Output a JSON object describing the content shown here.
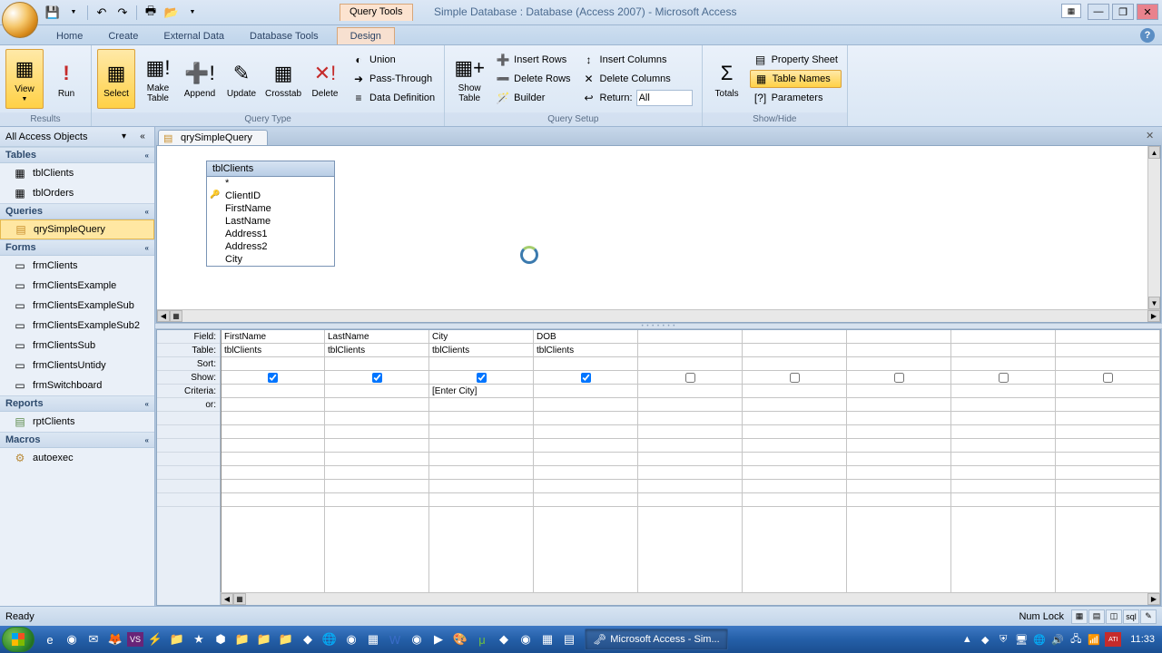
{
  "title": "Simple Database : Database (Access 2007) - Microsoft Access",
  "contextual_tab": "Query Tools",
  "tabs": [
    "Home",
    "Create",
    "External Data",
    "Database Tools",
    "Design"
  ],
  "active_tab_index": 4,
  "ribbon": {
    "results": {
      "label": "Results",
      "view": "View",
      "run": "Run"
    },
    "query_type": {
      "label": "Query Type",
      "select": "Select",
      "make_table": "Make Table",
      "append": "Append",
      "update": "Update",
      "crosstab": "Crosstab",
      "delete": "Delete",
      "union": "Union",
      "passthrough": "Pass-Through",
      "data_def": "Data Definition"
    },
    "setup": {
      "label": "Query Setup",
      "show_table": "Show Table",
      "insert_rows": "Insert Rows",
      "delete_rows": "Delete Rows",
      "builder": "Builder",
      "insert_cols": "Insert Columns",
      "delete_cols": "Delete Columns",
      "return": "Return:",
      "return_value": "All"
    },
    "showhide": {
      "label": "Show/Hide",
      "totals": "Totals",
      "property": "Property Sheet",
      "table_names": "Table Names",
      "parameters": "Parameters"
    }
  },
  "nav": {
    "title": "All Access Objects",
    "groups": {
      "tables": {
        "label": "Tables",
        "items": [
          "tblClients",
          "tblOrders"
        ]
      },
      "queries": {
        "label": "Queries",
        "items": [
          "qrySimpleQuery"
        ]
      },
      "forms": {
        "label": "Forms",
        "items": [
          "frmClients",
          "frmClientsExample",
          "frmClientsExampleSub",
          "frmClientsExampleSub2",
          "frmClientsSub",
          "frmClientsUntidy",
          "frmSwitchboard"
        ]
      },
      "reports": {
        "label": "Reports",
        "items": [
          "rptClients"
        ]
      },
      "macros": {
        "label": "Macros",
        "items": [
          "autoexec"
        ]
      }
    }
  },
  "doc_tab": "qrySimpleQuery",
  "table_box": {
    "name": "tblClients",
    "fields": [
      "*",
      "ClientID",
      "FirstName",
      "LastName",
      "Address1",
      "Address2",
      "City"
    ]
  },
  "grid": {
    "labels": [
      "Field:",
      "Table:",
      "Sort:",
      "Show:",
      "Criteria:",
      "or:"
    ],
    "columns": [
      {
        "field": "FirstName",
        "table": "tblClients",
        "sort": "",
        "show": true,
        "criteria": "",
        "or": ""
      },
      {
        "field": "LastName",
        "table": "tblClients",
        "sort": "",
        "show": true,
        "criteria": "",
        "or": ""
      },
      {
        "field": "City",
        "table": "tblClients",
        "sort": "",
        "show": true,
        "criteria": "[Enter City]",
        "or": ""
      },
      {
        "field": "DOB",
        "table": "tblClients",
        "sort": "",
        "show": true,
        "criteria": "",
        "or": ""
      },
      {
        "field": "",
        "table": "",
        "sort": "",
        "show": false,
        "criteria": "",
        "or": ""
      },
      {
        "field": "",
        "table": "",
        "sort": "",
        "show": false,
        "criteria": "",
        "or": ""
      },
      {
        "field": "",
        "table": "",
        "sort": "",
        "show": false,
        "criteria": "",
        "or": ""
      },
      {
        "field": "",
        "table": "",
        "sort": "",
        "show": false,
        "criteria": "",
        "or": ""
      },
      {
        "field": "",
        "table": "",
        "sort": "",
        "show": false,
        "criteria": "",
        "or": ""
      }
    ]
  },
  "status": {
    "ready": "Ready",
    "numlock": "Num Lock"
  },
  "taskbar": {
    "app": "Microsoft Access - Sim...",
    "time": "11:33"
  }
}
